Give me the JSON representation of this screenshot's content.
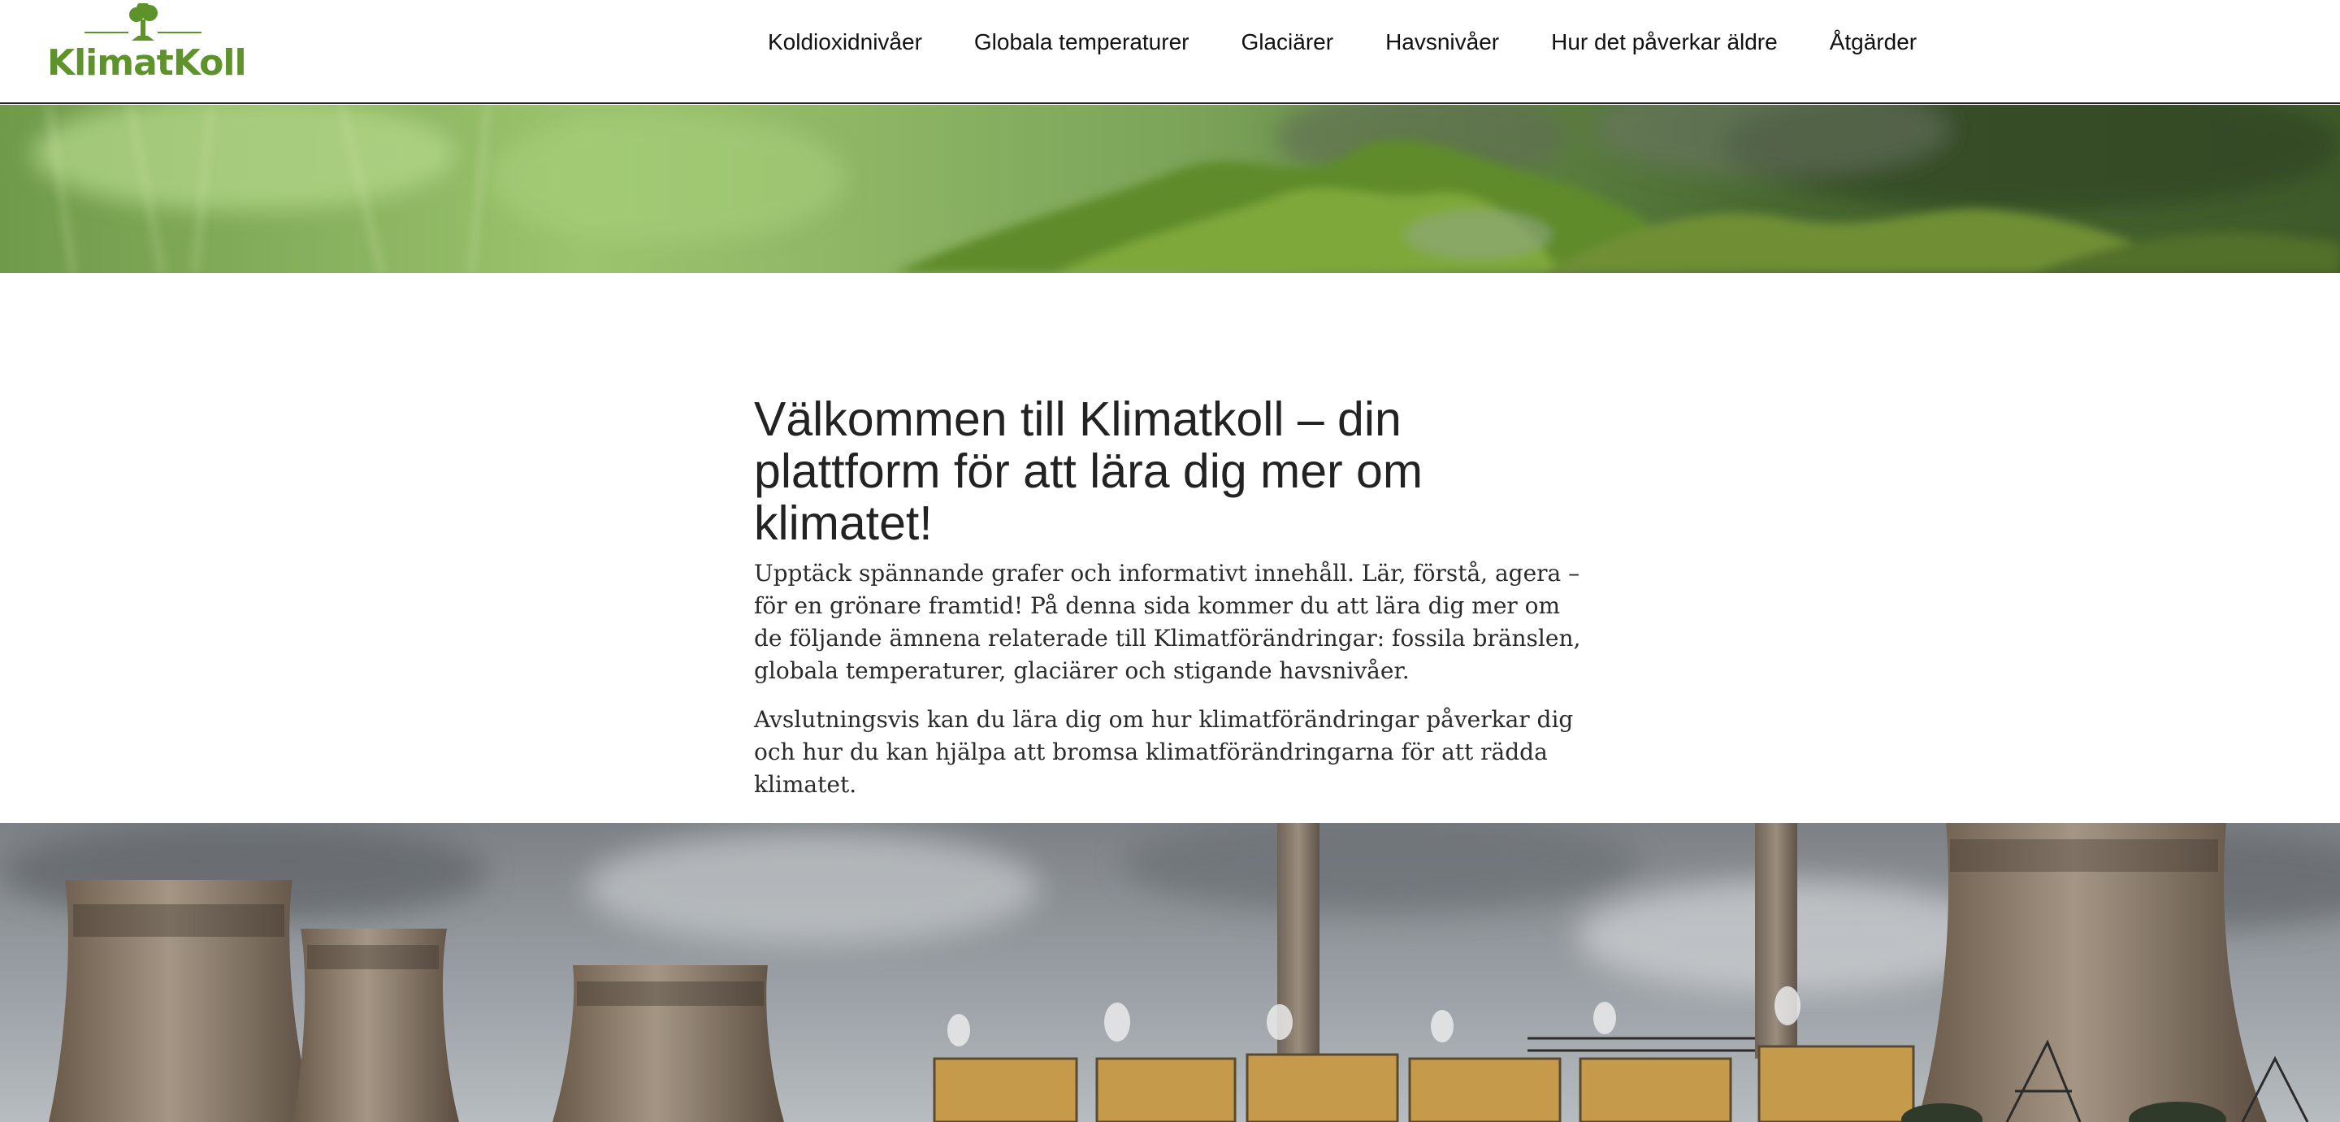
{
  "brand": {
    "name": "KlimatKoll",
    "color": "#5e922a",
    "icon": "tree-icon"
  },
  "nav": {
    "items": [
      {
        "label": "Koldioxidnivåer"
      },
      {
        "label": "Globala temperaturer"
      },
      {
        "label": "Glaciärer"
      },
      {
        "label": "Havsnivåer"
      },
      {
        "label": "Hur det påverkar äldre"
      },
      {
        "label": "Åtgärder"
      }
    ]
  },
  "hero_top": {
    "subject": "moss-covered forest"
  },
  "main": {
    "title": "Välkommen till Klimatkoll – din plattform för att lära dig mer om klimatet!",
    "paragraphs": [
      "Upptäck spännande grafer och informativt innehåll. Lär, förstå, agera – för en grönare framtid! På denna sida kommer du att lära dig mer om de följande ämnena relaterade till Klimatförändringar: fossila bränslen, globala temperaturer, glaciärer och stigande havsnivåer.",
      "Avslutningsvis kan du lära dig om hur klimatförändringar påverkar dig och hur du kan hjälpa att bromsa klimatförändringarna för att rädda klimatet."
    ]
  },
  "hero_bottom": {
    "subject": "power plant with cooling towers"
  }
}
